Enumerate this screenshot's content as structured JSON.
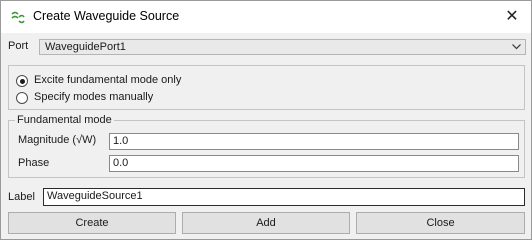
{
  "window": {
    "title": "Create Waveguide Source",
    "close_glyph": "✕"
  },
  "port": {
    "label": "Port",
    "selected": "WaveguidePort1"
  },
  "excitation": {
    "options": [
      {
        "label": "Excite fundamental mode only",
        "checked": true
      },
      {
        "label": "Specify modes manually",
        "checked": false
      }
    ]
  },
  "fundamental_mode": {
    "legend": "Fundamental mode",
    "magnitude_label": "Magnitude (√W)",
    "magnitude_value": "1.0",
    "phase_label": "Phase",
    "phase_value": "0.0"
  },
  "source_label": {
    "label": "Label",
    "value": "WaveguideSource1"
  },
  "buttons": {
    "create": "Create",
    "add": "Add",
    "close": "Close"
  },
  "colors": {
    "app_icon": "#3a9a3a",
    "window_bg": "#f0f0f0",
    "titlebar_bg": "#ffffff"
  },
  "icons": {
    "app": "app-logo-icon",
    "close": "close-icon",
    "dropdown": "chevron-down-icon"
  }
}
